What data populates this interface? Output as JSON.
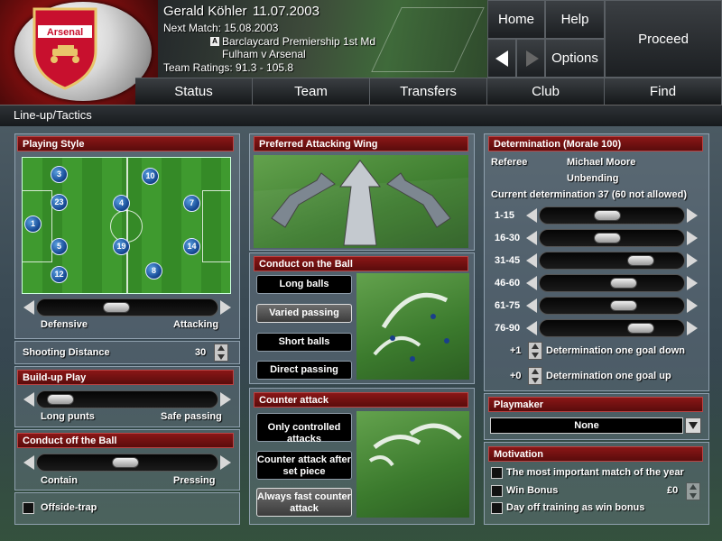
{
  "header": {
    "club_name": "Arsenal",
    "manager_name": "Gerald Köhler",
    "current_date": "11.07.2003",
    "next_match": "Next Match: 15.08.2003",
    "competition_icon": "A",
    "competition": "Barclaycard Premiership 1st Md",
    "fixture": "Fulham v Arsenal",
    "team_ratings": "Team Ratings: 91.3 - 105.8",
    "buttons": {
      "home": "Home",
      "help": "Help",
      "options": "Options",
      "proceed": "Proceed"
    },
    "nav": [
      "Status",
      "Team",
      "Transfers",
      "Club",
      "Find"
    ]
  },
  "page_title": "Line-up/Tactics",
  "playing_style": {
    "title": "Playing Style",
    "players": [
      "3",
      "10",
      "23",
      "4",
      "7",
      "1",
      "5",
      "19",
      "14",
      "12",
      "8"
    ],
    "slider_min": "Defensive",
    "slider_max": "Attacking",
    "slider_value": 0.42
  },
  "shooting_distance": {
    "label": "Shooting Distance",
    "value": "30"
  },
  "build_up": {
    "title": "Build-up Play",
    "min": "Long punts",
    "max": "Safe passing",
    "value": 0.04
  },
  "conduct_off": {
    "title": "Conduct off the Ball",
    "min": "Contain",
    "max": "Pressing",
    "value": 0.48
  },
  "offside_trap": {
    "label": "Offside-trap",
    "checked": false
  },
  "attacking_wing": {
    "title": "Preferred Attacking Wing"
  },
  "conduct_on": {
    "title": "Conduct on the Ball",
    "options": [
      "Long balls",
      "Varied passing",
      "Short balls",
      "Direct passing"
    ],
    "selected": 1
  },
  "counter_attack": {
    "title": "Counter attack",
    "options": [
      "Only controlled attacks",
      "Counter attack after set piece",
      "Always fast counter attack"
    ],
    "selected": 2
  },
  "determination": {
    "title": "Determination (Morale 100)",
    "referee_label": "Referee",
    "referee_name": "Michael Moore",
    "referee_trait": "Unbending",
    "current": "Current determination 37 (60 not allowed)",
    "periods": [
      {
        "label": "1-15",
        "value": 0.45
      },
      {
        "label": "16-30",
        "value": 0.45
      },
      {
        "label": "31-45",
        "value": 0.75
      },
      {
        "label": "46-60",
        "value": 0.6
      },
      {
        "label": "61-75",
        "value": 0.6
      },
      {
        "label": "76-90",
        "value": 0.75
      }
    ],
    "goal_down_value": "+1",
    "goal_down_label": "Determination one goal down",
    "goal_up_value": "+0",
    "goal_up_label": "Determination one goal up"
  },
  "playmaker": {
    "title": "Playmaker",
    "value": "None"
  },
  "motivation": {
    "title": "Motivation",
    "items": [
      "The most important match of the year",
      "Win Bonus",
      "Day off training as win bonus"
    ],
    "win_bonus_amount": "£0"
  }
}
